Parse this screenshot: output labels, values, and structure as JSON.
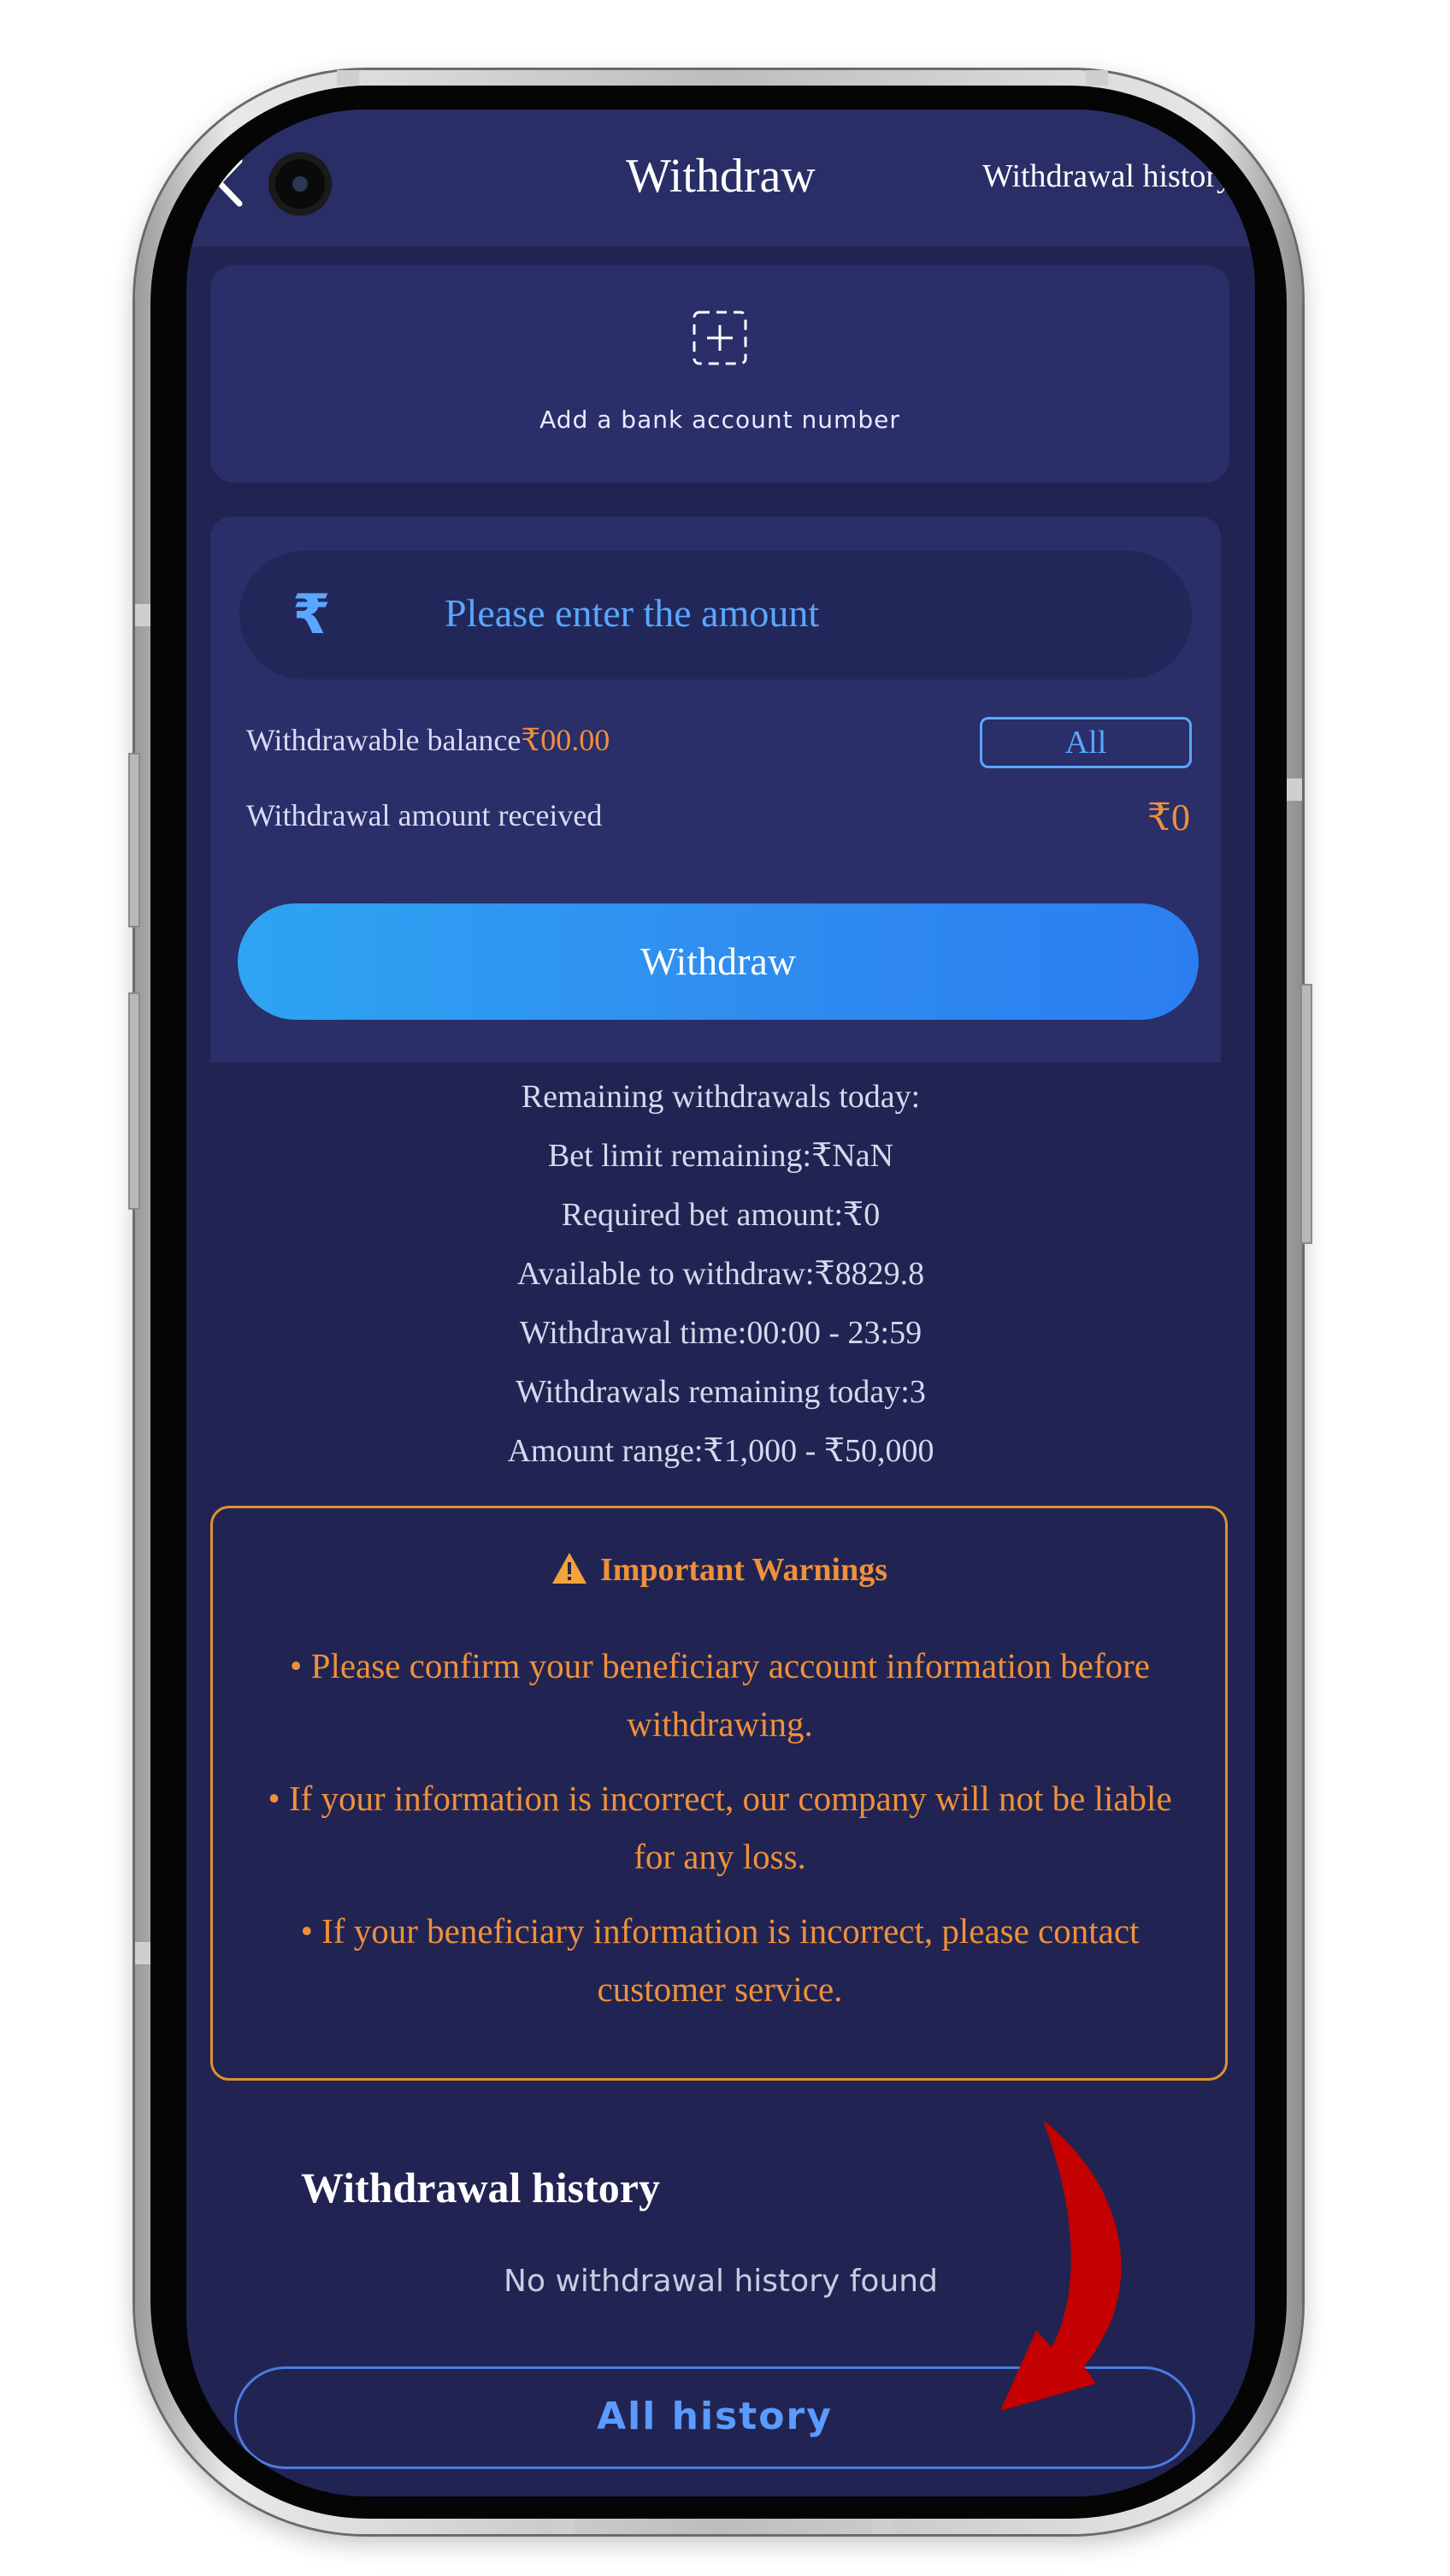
{
  "header": {
    "title": "Withdraw",
    "history_link": "Withdrawal history"
  },
  "bank": {
    "add_label": "Add a bank account number"
  },
  "amount": {
    "currency_symbol": "₹",
    "placeholder": "Please enter the amount",
    "balance_label": "Withdrawable balance",
    "balance_value": "₹00.00",
    "all_label": "All",
    "received_label": "Withdrawal amount received",
    "received_value": "₹0",
    "withdraw_button": "Withdraw"
  },
  "info": [
    "Remaining withdrawals today:",
    "Bet limit remaining:₹NaN",
    "Required bet amount:₹0",
    "Available to withdraw:₹8829.8",
    "Withdrawal time:00:00 - 23:59",
    "Withdrawals remaining today:3",
    "Amount range:₹1,000 - ₹50,000"
  ],
  "warnings": {
    "title": "Important Warnings",
    "items": [
      "• Please confirm your beneficiary account information before withdrawing.",
      "• If your information is incorrect, our company will not be liable for any loss.",
      "• If your beneficiary information is incorrect, please contact customer service."
    ]
  },
  "history": {
    "title": "Withdrawal history",
    "empty_text": "No withdrawal history found",
    "all_button": "All history"
  },
  "colors": {
    "background": "#212452",
    "card": "#2a2e69",
    "accent_blue": "#5aa7ff",
    "accent_orange": "#f0903a",
    "annotation_arrow": "#c40000"
  }
}
